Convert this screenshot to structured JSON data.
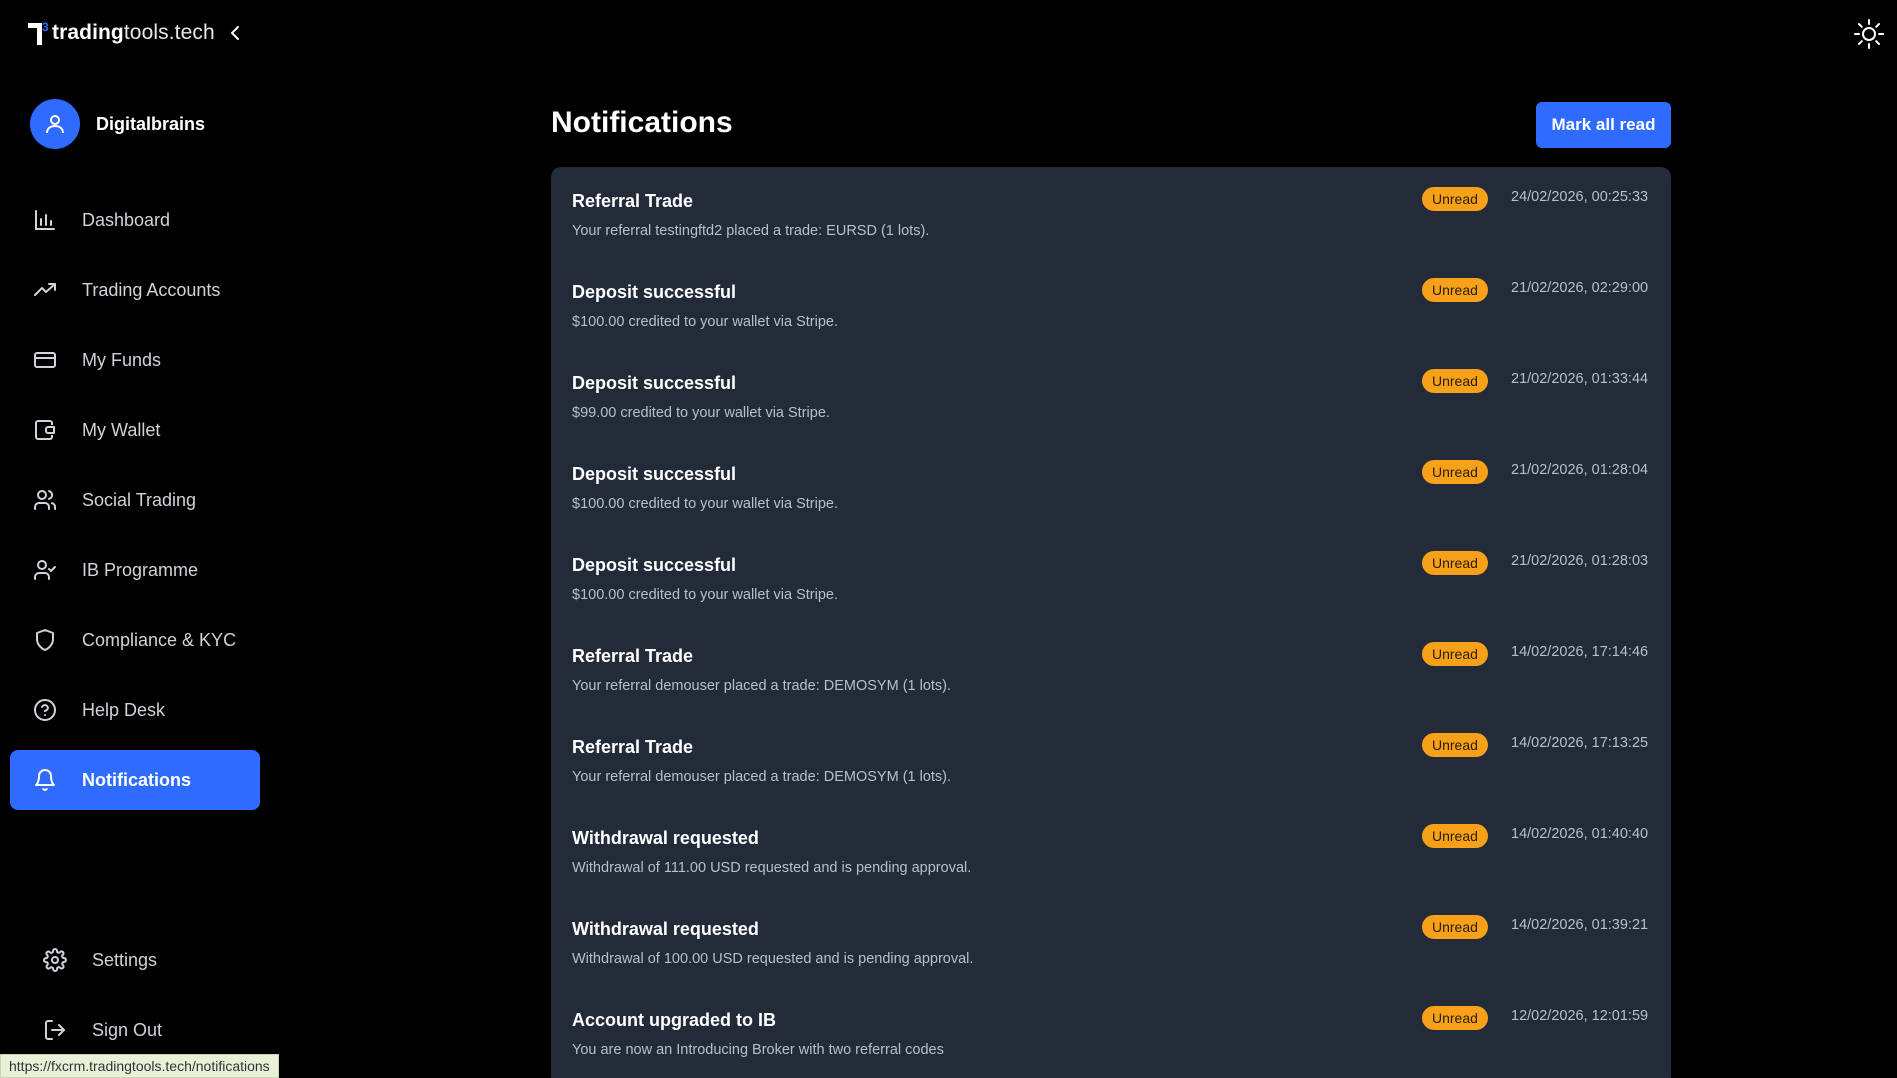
{
  "brand": {
    "logo_mark": "3",
    "name_bold": "trading",
    "name_light": "tools.tech"
  },
  "user": {
    "name": "Digitalbrains",
    "avatar_icon": "user-icon"
  },
  "sidebar": {
    "items": [
      {
        "label": "Dashboard",
        "icon": "bar-chart-icon",
        "active": false
      },
      {
        "label": "Trading Accounts",
        "icon": "trending-up-icon",
        "active": false
      },
      {
        "label": "My Funds",
        "icon": "credit-card-icon",
        "active": false
      },
      {
        "label": "My Wallet",
        "icon": "wallet-icon",
        "active": false
      },
      {
        "label": "Social Trading",
        "icon": "users-icon",
        "active": false
      },
      {
        "label": "IB Programme",
        "icon": "user-check-icon",
        "active": false
      },
      {
        "label": "Compliance & KYC",
        "icon": "shield-icon",
        "active": false
      },
      {
        "label": "Help Desk",
        "icon": "help-circle-icon",
        "active": false
      },
      {
        "label": "Notifications",
        "icon": "bell-icon",
        "active": true
      }
    ],
    "bottom_items": [
      {
        "label": "Settings",
        "icon": "gear-icon"
      },
      {
        "label": "Sign Out",
        "icon": "sign-out-icon"
      }
    ]
  },
  "page": {
    "title": "Notifications",
    "mark_all_read_label": "Mark all read"
  },
  "notifications": [
    {
      "title": "Referral Trade",
      "message": "Your referral testingftd2 placed a trade: EURSD (1 lots).",
      "status": "Unread",
      "timestamp": "24/02/2026, 00:25:33"
    },
    {
      "title": "Deposit successful",
      "message": "$100.00 credited to your wallet via Stripe.",
      "status": "Unread",
      "timestamp": "21/02/2026, 02:29:00"
    },
    {
      "title": "Deposit successful",
      "message": "$99.00 credited to your wallet via Stripe.",
      "status": "Unread",
      "timestamp": "21/02/2026, 01:33:44"
    },
    {
      "title": "Deposit successful",
      "message": "$100.00 credited to your wallet via Stripe.",
      "status": "Unread",
      "timestamp": "21/02/2026, 01:28:04"
    },
    {
      "title": "Deposit successful",
      "message": "$100.00 credited to your wallet via Stripe.",
      "status": "Unread",
      "timestamp": "21/02/2026, 01:28:03"
    },
    {
      "title": "Referral Trade",
      "message": "Your referral demouser placed a trade: DEMOSYM (1 lots).",
      "status": "Unread",
      "timestamp": "14/02/2026, 17:14:46"
    },
    {
      "title": "Referral Trade",
      "message": "Your referral demouser placed a trade: DEMOSYM (1 lots).",
      "status": "Unread",
      "timestamp": "14/02/2026, 17:13:25"
    },
    {
      "title": "Withdrawal requested",
      "message": "Withdrawal of 111.00 USD requested and is pending approval.",
      "status": "Unread",
      "timestamp": "14/02/2026, 01:40:40"
    },
    {
      "title": "Withdrawal requested",
      "message": "Withdrawal of 100.00 USD requested and is pending approval.",
      "status": "Unread",
      "timestamp": "14/02/2026, 01:39:21"
    },
    {
      "title": "Account upgraded to IB",
      "message": "You are now an Introducing Broker with two referral codes",
      "status": "Unread",
      "timestamp": "12/02/2026, 12:01:59"
    }
  ],
  "browser_status_url": "https://fxcrm.tradingtools.tech/notifications",
  "colors": {
    "accent": "#2f6bff",
    "badge": "#f7a11a",
    "panel": "#232b39",
    "background": "#000000"
  }
}
